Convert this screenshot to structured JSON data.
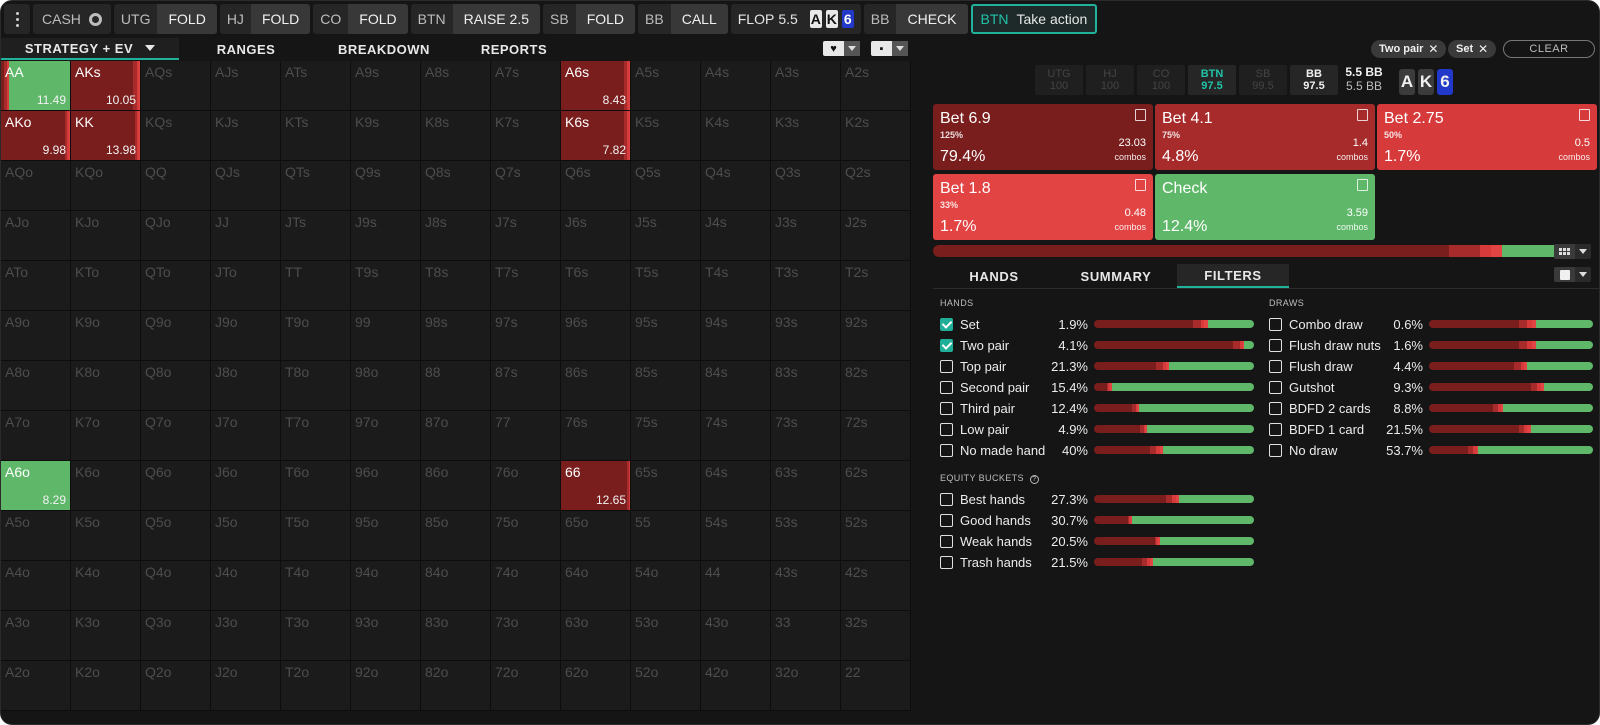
{
  "colors": {
    "bet_dark": "#7a1d1d",
    "bet_mid": "#a72b2b",
    "bet_light": "#e24343",
    "check_green": "#5fb86a",
    "accent_teal": "#21b29b"
  },
  "topbar": {
    "cash_label": "CASH",
    "steps": [
      {
        "pos": "UTG",
        "action": "FOLD"
      },
      {
        "pos": "HJ",
        "action": "FOLD"
      },
      {
        "pos": "CO",
        "action": "FOLD"
      },
      {
        "pos": "BTN",
        "action": "RAISE 2.5"
      },
      {
        "pos": "SB",
        "action": "FOLD"
      },
      {
        "pos": "BB",
        "action": "CALL"
      }
    ],
    "flop_label": "FLOP",
    "flop_pot": "5.5",
    "flop_cards": [
      "A",
      "K",
      "6"
    ],
    "bb_step": {
      "pos": "BB",
      "action": "CHECK"
    },
    "take": {
      "pos": "BTN",
      "label": "Take action"
    }
  },
  "tabs": {
    "strategy": "STRATEGY + EV",
    "ranges": "RANGES",
    "breakdown": "BREAKDOWN",
    "reports": "REPORTS"
  },
  "grid": {
    "hands": [
      [
        "AA",
        "AKs",
        "AQs",
        "AJs",
        "ATs",
        "A9s",
        "A8s",
        "A7s",
        "A6s",
        "A5s",
        "A4s",
        "A3s",
        "A2s"
      ],
      [
        "AKo",
        "KK",
        "KQs",
        "KJs",
        "KTs",
        "K9s",
        "K8s",
        "K7s",
        "K6s",
        "K5s",
        "K4s",
        "K3s",
        "K2s"
      ],
      [
        "AQo",
        "KQo",
        "QQ",
        "QJs",
        "QTs",
        "Q9s",
        "Q8s",
        "Q7s",
        "Q6s",
        "Q5s",
        "Q4s",
        "Q3s",
        "Q2s"
      ],
      [
        "AJo",
        "KJo",
        "QJo",
        "JJ",
        "JTs",
        "J9s",
        "J8s",
        "J7s",
        "J6s",
        "J5s",
        "J4s",
        "J3s",
        "J2s"
      ],
      [
        "ATo",
        "KTo",
        "QTo",
        "JTo",
        "TT",
        "T9s",
        "T8s",
        "T7s",
        "T6s",
        "T5s",
        "T4s",
        "T3s",
        "T2s"
      ],
      [
        "A9o",
        "K9o",
        "Q9o",
        "J9o",
        "T9o",
        "99",
        "98s",
        "97s",
        "96s",
        "95s",
        "94s",
        "93s",
        "92s"
      ],
      [
        "A8o",
        "K8o",
        "Q8o",
        "J8o",
        "T8o",
        "98o",
        "88",
        "87s",
        "86s",
        "85s",
        "84s",
        "83s",
        "82s"
      ],
      [
        "A7o",
        "K7o",
        "Q7o",
        "J7o",
        "T7o",
        "97o",
        "87o",
        "77",
        "76s",
        "75s",
        "74s",
        "73s",
        "72s"
      ],
      [
        "A6o",
        "K6o",
        "Q6o",
        "J6o",
        "T6o",
        "96o",
        "86o",
        "76o",
        "66",
        "65s",
        "64s",
        "63s",
        "62s"
      ],
      [
        "A5o",
        "K5o",
        "Q5o",
        "J5o",
        "T5o",
        "95o",
        "85o",
        "75o",
        "65o",
        "55",
        "54s",
        "53s",
        "52s"
      ],
      [
        "A4o",
        "K4o",
        "Q4o",
        "J4o",
        "T4o",
        "94o",
        "84o",
        "74o",
        "64o",
        "54o",
        "44",
        "43s",
        "42s"
      ],
      [
        "A3o",
        "K3o",
        "Q3o",
        "J3o",
        "T3o",
        "93o",
        "83o",
        "73o",
        "63o",
        "53o",
        "43o",
        "33",
        "32s"
      ],
      [
        "A2o",
        "K2o",
        "Q2o",
        "J2o",
        "T2o",
        "92o",
        "82o",
        "72o",
        "62o",
        "52o",
        "42o",
        "32o",
        "22"
      ]
    ],
    "active": {
      "AA": {
        "ev": "11.49",
        "mix": [
          0.05,
          0.03,
          0.03,
          0.0,
          0.89
        ]
      },
      "AKs": {
        "ev": "10.05",
        "mix": [
          0.9,
          0.05,
          0.03,
          0.02,
          0.0
        ]
      },
      "A6s": {
        "ev": "8.43",
        "mix": [
          0.92,
          0.04,
          0.02,
          0.02,
          0.0
        ]
      },
      "AKo": {
        "ev": "9.98",
        "mix": [
          0.93,
          0.03,
          0.02,
          0.02,
          0.0
        ]
      },
      "KK": {
        "ev": "13.98",
        "mix": [
          0.93,
          0.03,
          0.02,
          0.02,
          0.0
        ]
      },
      "K6s": {
        "ev": "7.82",
        "mix": [
          0.92,
          0.04,
          0.02,
          0.02,
          0.0
        ]
      },
      "A6o": {
        "ev": "8.29",
        "mix": [
          0.0,
          0.0,
          0.0,
          0.0,
          1.0
        ]
      },
      "66": {
        "ev": "12.65",
        "mix": [
          0.96,
          0.02,
          0.02,
          0.0,
          0.0
        ]
      }
    }
  },
  "filters_chips": {
    "two_pair": "Two pair",
    "set": "Set",
    "clear": "CLEAR"
  },
  "seats": [
    {
      "pos": "UTG",
      "stack": "100"
    },
    {
      "pos": "HJ",
      "stack": "100"
    },
    {
      "pos": "CO",
      "stack": "100"
    },
    {
      "pos": "BTN",
      "stack": "97.5"
    },
    {
      "pos": "SB",
      "stack": "99.5"
    },
    {
      "pos": "BB",
      "stack": "97.5"
    }
  ],
  "pot": {
    "top": "5.5 BB",
    "bottom": "5.5 BB"
  },
  "board": [
    "A",
    "K",
    "6"
  ],
  "actions": [
    {
      "name": "Bet 6.9",
      "sub": "125%",
      "pct": "79.4%",
      "combos": "23.03",
      "combos_label": "combos"
    },
    {
      "name": "Bet 4.1",
      "sub": "75%",
      "pct": "4.8%",
      "combos": "1.4",
      "combos_label": "combos"
    },
    {
      "name": "Bet 2.75",
      "sub": "50%",
      "pct": "1.7%",
      "combos": "0.5",
      "combos_label": "combos"
    },
    {
      "name": "Bet 1.8",
      "sub": "33%",
      "pct": "1.7%",
      "combos": "0.48",
      "combos_label": "combos"
    },
    {
      "name": "Check",
      "sub": "",
      "pct": "12.4%",
      "combos": "3.59",
      "combos_label": "combos"
    }
  ],
  "overall_mix": [
    0.794,
    0.048,
    0.017,
    0.017,
    0.124
  ],
  "subtabs": {
    "hands": "HANDS",
    "summary": "SUMMARY",
    "filters": "FILTERS"
  },
  "sections": {
    "hands": "HANDS",
    "draws": "DRAWS",
    "equity": "EQUITY BUCKETS"
  },
  "hands_filters": [
    {
      "name": "Set",
      "pct": "1.9%",
      "checked": true,
      "mix": [
        0.62,
        0.05,
        0.02,
        0.02,
        0.29
      ]
    },
    {
      "name": "Two pair",
      "pct": "4.1%",
      "checked": true,
      "mix": [
        0.87,
        0.04,
        0.02,
        0.01,
        0.06
      ]
    },
    {
      "name": "Top pair",
      "pct": "21.3%",
      "checked": false,
      "mix": [
        0.39,
        0.04,
        0.02,
        0.02,
        0.53
      ]
    },
    {
      "name": "Second pair",
      "pct": "15.4%",
      "checked": false,
      "mix": [
        0.08,
        0.01,
        0.01,
        0.01,
        0.89
      ]
    },
    {
      "name": "Third pair",
      "pct": "12.4%",
      "checked": false,
      "mix": [
        0.24,
        0.02,
        0.01,
        0.01,
        0.72
      ]
    },
    {
      "name": "Low pair",
      "pct": "4.9%",
      "checked": false,
      "mix": [
        0.29,
        0.02,
        0.01,
        0.01,
        0.67
      ]
    },
    {
      "name": "No made hand",
      "pct": "40%",
      "checked": false,
      "mix": [
        0.35,
        0.04,
        0.02,
        0.02,
        0.57
      ]
    }
  ],
  "draws_filters": [
    {
      "name": "Combo draw",
      "pct": "0.6%",
      "checked": false,
      "mix": [
        0.55,
        0.05,
        0.03,
        0.02,
        0.35
      ]
    },
    {
      "name": "Flush draw nuts",
      "pct": "1.6%",
      "checked": false,
      "mix": [
        0.55,
        0.05,
        0.03,
        0.02,
        0.35
      ]
    },
    {
      "name": "Flush draw",
      "pct": "4.4%",
      "checked": false,
      "mix": [
        0.52,
        0.04,
        0.02,
        0.02,
        0.4
      ]
    },
    {
      "name": "Gutshot",
      "pct": "9.3%",
      "checked": false,
      "mix": [
        0.62,
        0.04,
        0.02,
        0.02,
        0.3
      ]
    },
    {
      "name": "BDFD 2 cards",
      "pct": "8.8%",
      "checked": false,
      "mix": [
        0.39,
        0.03,
        0.02,
        0.01,
        0.55
      ]
    },
    {
      "name": "BDFD 1 card",
      "pct": "21.5%",
      "checked": false,
      "mix": [
        0.55,
        0.03,
        0.02,
        0.02,
        0.38
      ]
    },
    {
      "name": "No draw",
      "pct": "53.7%",
      "checked": false,
      "mix": [
        0.24,
        0.03,
        0.02,
        0.01,
        0.7
      ]
    }
  ],
  "equity_filters": [
    {
      "name": "Best hands",
      "pct": "27.3%",
      "checked": false,
      "mix": [
        0.45,
        0.04,
        0.02,
        0.02,
        0.47
      ]
    },
    {
      "name": "Good hands",
      "pct": "30.7%",
      "checked": false,
      "mix": [
        0.21,
        0.01,
        0.01,
        0.01,
        0.76
      ]
    },
    {
      "name": "Weak hands",
      "pct": "20.5%",
      "checked": false,
      "mix": [
        0.38,
        0.01,
        0.01,
        0.01,
        0.59
      ]
    },
    {
      "name": "Trash hands",
      "pct": "21.5%",
      "checked": false,
      "mix": [
        0.3,
        0.03,
        0.02,
        0.02,
        0.63
      ]
    }
  ]
}
